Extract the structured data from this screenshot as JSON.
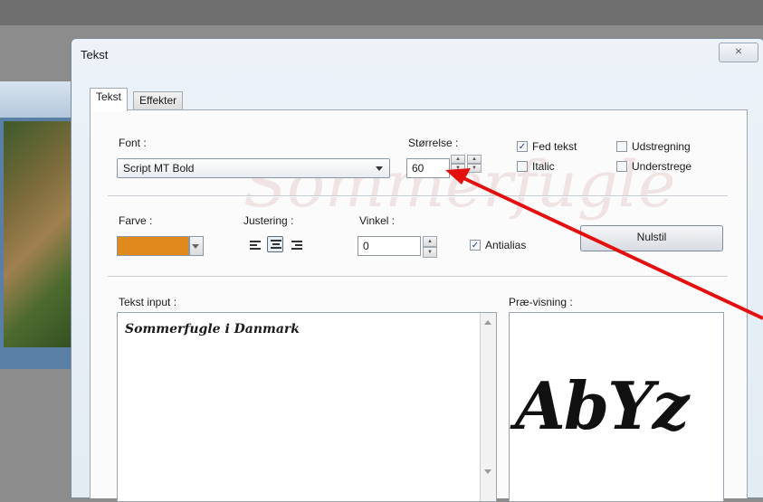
{
  "dialog": {
    "title": "Tekst",
    "close_glyph": "⨯"
  },
  "tabs": [
    {
      "label": "Tekst"
    },
    {
      "label": "Effekter"
    }
  ],
  "font": {
    "label": "Font :",
    "value": "Script MT Bold"
  },
  "size": {
    "label": "Størrelse :",
    "value": "60"
  },
  "checkboxes": {
    "bold": {
      "label": "Fed tekst",
      "checked": true
    },
    "italic": {
      "label": "Italic",
      "checked": false
    },
    "strike": {
      "label": "Udstregning",
      "checked": false
    },
    "underline": {
      "label": "Understrege",
      "checked": false
    },
    "antialias": {
      "label": "Antialias",
      "checked": true
    }
  },
  "color": {
    "label": "Farve :",
    "value_hex": "#e08a1e"
  },
  "justify": {
    "label": "Justering :",
    "selected": "center"
  },
  "angle": {
    "label": "Vinkel :",
    "value": "0"
  },
  "reset_button": "Nulstil",
  "text_input": {
    "label": "Tekst input :",
    "value": "Sommerfugle i Danmark"
  },
  "preview": {
    "label": "Præ-visning :",
    "sample": "AbYz"
  },
  "watermark_text": "Sommerfugle",
  "annotation": {
    "color": "#e31010"
  }
}
